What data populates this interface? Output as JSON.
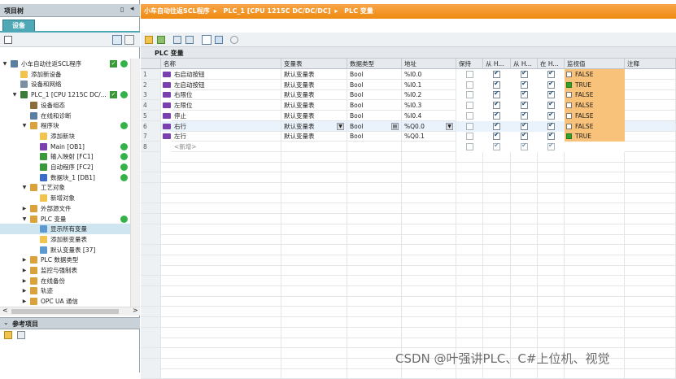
{
  "project_tree": {
    "title": "项目树",
    "tab": "设备",
    "items": [
      {
        "label": "小车自动往返SCL程序",
        "check": true,
        "dot": true
      },
      {
        "label": "添加新设备"
      },
      {
        "label": "设备和网络"
      },
      {
        "label": "PLC_1 [CPU 1215C DC/...",
        "check": true,
        "dot": true
      },
      {
        "label": "设备组态"
      },
      {
        "label": "在线和诊断"
      },
      {
        "label": "程序块",
        "dot": true
      },
      {
        "label": "添加新块"
      },
      {
        "label": "Main [OB1]",
        "dot": true
      },
      {
        "label": "输入映射 [FC1]",
        "dot": true
      },
      {
        "label": "自动程序 [FC2]",
        "dot": true
      },
      {
        "label": "数据块_1 [DB1]",
        "dot": true
      },
      {
        "label": "工艺对象"
      },
      {
        "label": "新增对象"
      },
      {
        "label": "外部源文件"
      },
      {
        "label": "PLC 变量",
        "dot": true
      },
      {
        "label": "显示所有变量"
      },
      {
        "label": "添加新变量表"
      },
      {
        "label": "默认变量表 [37]"
      },
      {
        "label": "PLC 数据类型"
      },
      {
        "label": "监控与强制表"
      },
      {
        "label": "在线备份"
      },
      {
        "label": "轨迹"
      },
      {
        "label": "OPC UA 通信"
      }
    ]
  },
  "reference": {
    "title": "参考项目"
  },
  "breadcrumb": [
    "小车自动往返SCL程序",
    "PLC_1 [CPU 1215C DC/DC/DC]",
    "PLC 变量"
  ],
  "editor_title": "PLC 变量",
  "columns": [
    "名称",
    "变量表",
    "数据类型",
    "地址",
    "保持",
    "从 H...",
    "从 H...",
    "在 H...",
    "监视值",
    "注释"
  ],
  "rows": [
    {
      "no": "1",
      "name": "右启动按钮",
      "table": "默认变量表",
      "type": "Bool",
      "addr": "%I0.0",
      "h1": true,
      "h2": true,
      "h3": true,
      "mon": "FALSE"
    },
    {
      "no": "2",
      "name": "左启动按钮",
      "table": "默认变量表",
      "type": "Bool",
      "addr": "%I0.1",
      "h1": true,
      "h2": true,
      "h3": true,
      "mon": "TRUE"
    },
    {
      "no": "3",
      "name": "右限位",
      "table": "默认变量表",
      "type": "Bool",
      "addr": "%I0.2",
      "h1": true,
      "h2": true,
      "h3": true,
      "mon": "FALSE"
    },
    {
      "no": "4",
      "name": "左限位",
      "table": "默认变量表",
      "type": "Bool",
      "addr": "%I0.3",
      "h1": true,
      "h2": true,
      "h3": true,
      "mon": "FALSE"
    },
    {
      "no": "5",
      "name": "停止",
      "table": "默认变量表",
      "type": "Bool",
      "addr": "%I0.4",
      "h1": true,
      "h2": true,
      "h3": true,
      "mon": "FALSE"
    },
    {
      "no": "6",
      "name": "右行",
      "table": "默认变量表",
      "type": "Bool",
      "addr": "%Q0.0",
      "h1": true,
      "h2": true,
      "h3": true,
      "mon": "FALSE"
    },
    {
      "no": "7",
      "name": "左行",
      "table": "默认变量表",
      "type": "Bool",
      "addr": "%Q0.1",
      "h1": true,
      "h2": true,
      "h3": true,
      "mon": "TRUE"
    },
    {
      "no": "8",
      "name": "<新增>",
      "table": "",
      "type": "",
      "addr": "",
      "h1": true,
      "h2": true,
      "h3": true,
      "mon": ""
    }
  ],
  "watermark": "CSDN @叶强讲PLC、C#上位机、视觉",
  "colors": {
    "breadcrumb": "#ee8a10",
    "monitor": "#f9c27a",
    "tab": "#4fa8b5",
    "status_ok": "#33b24a"
  }
}
